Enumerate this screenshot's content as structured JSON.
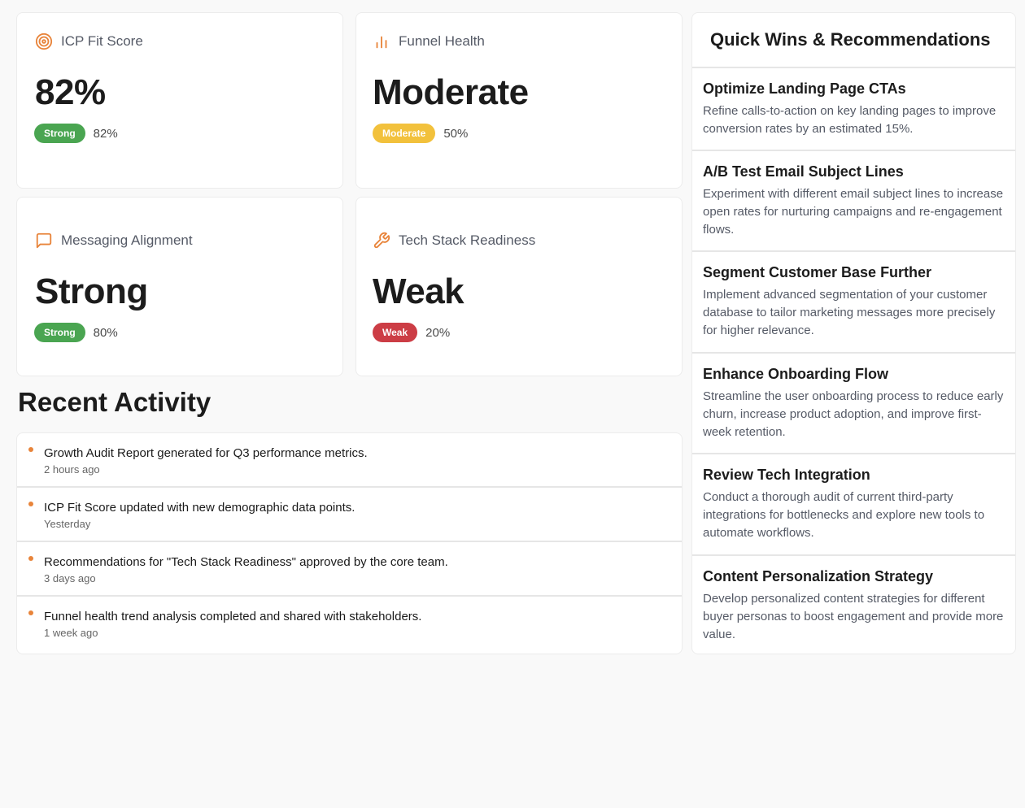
{
  "metrics": [
    {
      "label": "ICP Fit Score",
      "value": "82%",
      "badge": "Strong",
      "percent": "82%",
      "icon": "target-icon",
      "badge_color": "#4aa551"
    },
    {
      "label": "Funnel Health",
      "value": "Moderate",
      "badge": "Moderate",
      "percent": "50%",
      "icon": "bar-chart-icon",
      "badge_color": "#f2c13c"
    },
    {
      "label": "Messaging Alignment",
      "value": "Strong",
      "badge": "Strong",
      "percent": "80%",
      "icon": "message-square-icon",
      "badge_color": "#4aa551"
    },
    {
      "label": "Tech Stack Readiness",
      "value": "Weak",
      "badge": "Weak",
      "percent": "20%",
      "icon": "wrench-icon",
      "badge_color": "#cc3d45"
    }
  ],
  "accent_color": "#e8843a",
  "activity": {
    "title": "Recent Activity",
    "items": [
      {
        "text": "Growth Audit Report generated for Q3 performance metrics.",
        "time": "2 hours ago"
      },
      {
        "text": "ICP Fit Score updated with new demographic data points.",
        "time": "Yesterday"
      },
      {
        "text": "Recommendations for \"Tech Stack Readiness\" approved by the core team.",
        "time": "3 days ago"
      },
      {
        "text": "Funnel health trend analysis completed and shared with stakeholders.",
        "time": "1 week ago"
      }
    ]
  },
  "recommendations": {
    "title": "Quick Wins & Recommendations",
    "items": [
      {
        "title": "Optimize Landing Page CTAs",
        "desc": "Refine calls-to-action on key landing pages to improve conversion rates by an estimated 15%."
      },
      {
        "title": "A/B Test Email Subject Lines",
        "desc": "Experiment with different email subject lines to increase open rates for nurturing campaigns and re-engagement flows."
      },
      {
        "title": "Segment Customer Base Further",
        "desc": "Implement advanced segmentation of your customer database to tailor marketing messages more precisely for higher relevance."
      },
      {
        "title": "Enhance Onboarding Flow",
        "desc": "Streamline the user onboarding process to reduce early churn, increase product adoption, and improve first-week retention."
      },
      {
        "title": "Review Tech Integration",
        "desc": "Conduct a thorough audit of current third-party integrations for bottlenecks and explore new tools to automate workflows."
      },
      {
        "title": "Content Personalization Strategy",
        "desc": "Develop personalized content strategies for different buyer personas to boost engagement and provide more value."
      }
    ]
  }
}
